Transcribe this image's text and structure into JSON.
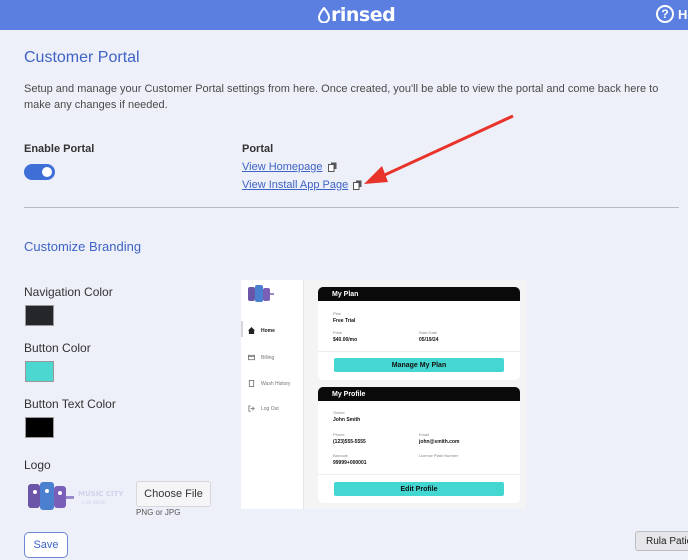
{
  "header": {
    "brand": "rinsed",
    "help_label": "He"
  },
  "page": {
    "title": "Customer Portal",
    "description": "Setup and manage your Customer Portal settings from here. Once created, you'll be able to view the portal and come back here to make any changes if needed."
  },
  "portal": {
    "enable_label": "Enable Portal",
    "enabled": true,
    "links_label": "Portal",
    "view_homepage": "View Homepage",
    "view_install": "View Install App Page"
  },
  "branding": {
    "title": "Customize Branding",
    "nav_color_label": "Navigation Color",
    "nav_color": "#24262a",
    "button_color_label": "Button Color",
    "button_color": "#4dd7d1",
    "button_text_color_label": "Button Text Color",
    "button_text_color": "#000000",
    "logo_label": "Logo",
    "logo_text": "MUSIC CITY CAR WASH",
    "choose_file": "Choose File",
    "file_hint": "PNG or JPG"
  },
  "preview": {
    "nav": [
      "Home",
      "Billing",
      "Wash History",
      "Log Out"
    ],
    "plan_card": {
      "title": "My Plan",
      "plan_label": "Plan",
      "plan_value": "Free Trial",
      "price_label": "Price",
      "price_value": "$40.00/mo",
      "start_label": "Start Date",
      "start_value": "05/19/24",
      "button": "Manage My Plan"
    },
    "profile_card": {
      "title": "My Profile",
      "owner_label": "Owner",
      "owner_value": "John Smith",
      "phone_label": "Phone",
      "phone_value": "(123)555-5555",
      "email_label": "Email",
      "email_value": "john@smith.com",
      "barcode_label": "Barcode",
      "barcode_value": "99999+000001",
      "plate_label": "License Plate Number",
      "button": "Edit Profile"
    }
  },
  "actions": {
    "save": "Save"
  },
  "chat_chip": "Rula Patie",
  "colors": {
    "accent": "#3e63c6",
    "topbar": "#5a7fe0",
    "arrow": "#e8332a"
  }
}
